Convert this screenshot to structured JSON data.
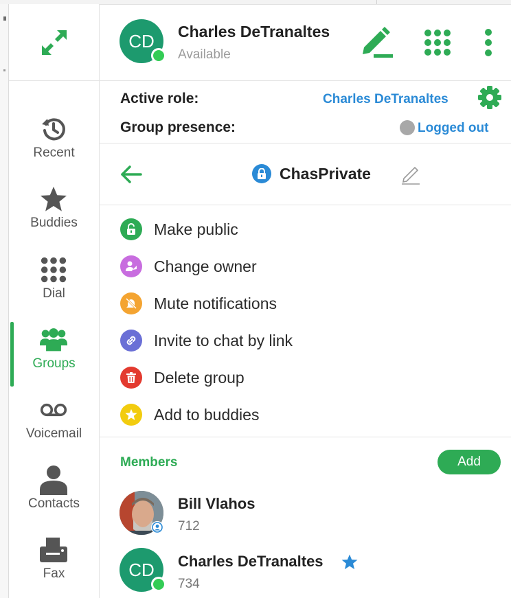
{
  "sidebar": {
    "items": [
      {
        "label": "Recent",
        "icon": "history-icon",
        "active": false
      },
      {
        "label": "Buddies",
        "icon": "star-icon",
        "active": false
      },
      {
        "label": "Dial",
        "icon": "dialpad-icon",
        "active": false
      },
      {
        "label": "Groups",
        "icon": "groups-icon",
        "active": true
      },
      {
        "label": "Voicemail",
        "icon": "voicemail-icon",
        "active": false
      },
      {
        "label": "Contacts",
        "icon": "contact-icon",
        "active": false
      },
      {
        "label": "Fax",
        "icon": "fax-icon",
        "active": false
      }
    ]
  },
  "header": {
    "avatar_initials": "CD",
    "name": "Charles DeTranaltes",
    "status": "Available"
  },
  "role": {
    "active_role_label": "Active role:",
    "active_role_value": "Charles DeTranaltes",
    "group_presence_label": "Group presence:",
    "group_presence_value": "Logged out"
  },
  "group": {
    "name": "ChasPrivate"
  },
  "actions": [
    {
      "label": "Make public",
      "icon": "unlock-icon",
      "color": "#2eab55"
    },
    {
      "label": "Change owner",
      "icon": "person-swap-icon",
      "color": "#c86ddf"
    },
    {
      "label": "Mute notifications",
      "icon": "mute-bell-icon",
      "color": "#f4a431"
    },
    {
      "label": "Invite to chat by link",
      "icon": "link-icon",
      "color": "#6a6fd6"
    },
    {
      "label": "Delete group",
      "icon": "trash-icon",
      "color": "#e33a2f"
    },
    {
      "label": "Add to buddies",
      "icon": "star-icon",
      "color": "#f2cc0f"
    }
  ],
  "members": {
    "title": "Members",
    "add_label": "Add",
    "list": [
      {
        "name": "Bill Vlahos",
        "ext": "712",
        "avatar": "photo"
      },
      {
        "name": "Charles DeTranaltes",
        "ext": "734",
        "avatar_initials": "CD",
        "starred": true
      }
    ]
  },
  "colors": {
    "accent_green": "#2eab55",
    "link_blue": "#2a8ad6",
    "avatar_teal": "#1d9a6e"
  }
}
